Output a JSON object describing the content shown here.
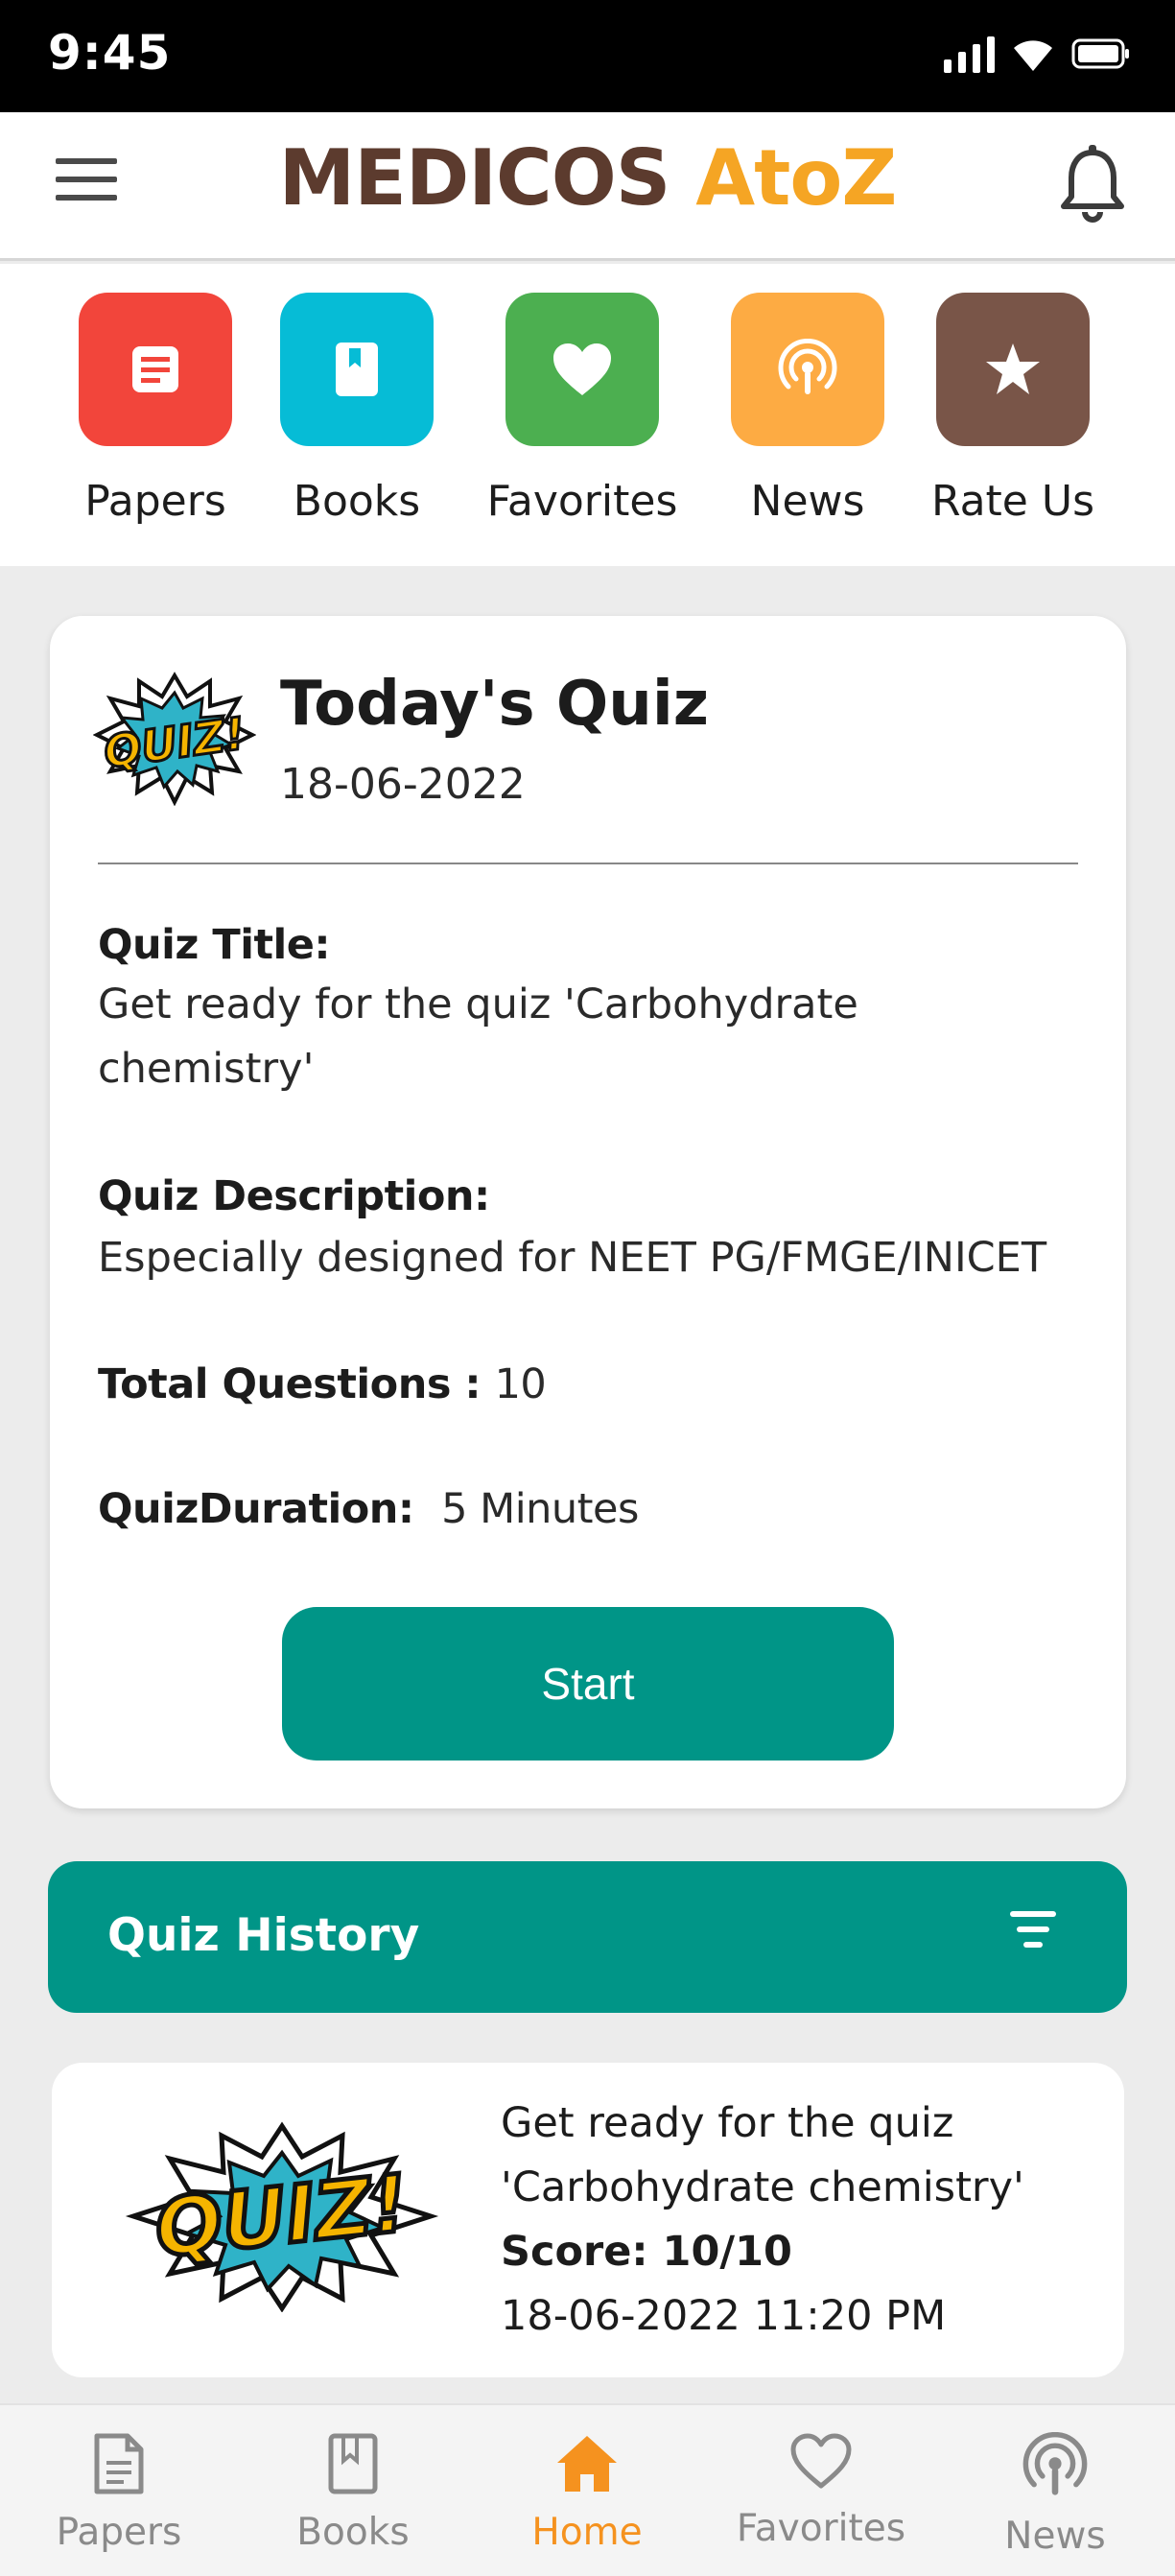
{
  "status_bar": {
    "time": "9:45"
  },
  "header": {
    "logo_part1": "MEDICOS",
    "logo_part2": "AtoZ"
  },
  "shortcuts": [
    {
      "label": "Papers",
      "icon": "document-icon",
      "color": "#f2453b"
    },
    {
      "label": "Books",
      "icon": "book-icon",
      "color": "#06bcd6"
    },
    {
      "label": "Favorites",
      "icon": "heart-icon",
      "color": "#4caf50"
    },
    {
      "label": "News",
      "icon": "broadcast-icon",
      "color": "#fdab43"
    },
    {
      "label": "Rate Us",
      "icon": "star-icon",
      "color": "#795548"
    }
  ],
  "quiz_card": {
    "logo_text": "QUIZ!",
    "heading": "Today's Quiz",
    "date": "18-06-2022",
    "title_label": "Quiz Title:",
    "title_value": "Get ready for the quiz 'Carbohydrate chemistry'",
    "description_label": "Quiz Description:",
    "description_value": "Especially designed for NEET PG/FMGE/INICET",
    "total_questions_label": "Total Questions :",
    "total_questions_value": "10",
    "duration_label": "QuizDuration:",
    "duration_value": "5 Minutes",
    "start_label": "Start"
  },
  "quiz_history": {
    "title": "Quiz History",
    "items": [
      {
        "logo_text": "QUIZ!",
        "title": "Get ready for the quiz 'Carbohydrate chemistry'",
        "score": "Score: 10/10",
        "datetime": "18-06-2022 11:20 PM"
      }
    ]
  },
  "bottom_nav": {
    "items": [
      {
        "label": "Papers",
        "icon": "document-outline-icon"
      },
      {
        "label": "Books",
        "icon": "book-outline-icon"
      },
      {
        "label": "Home",
        "icon": "home-icon",
        "active": true
      },
      {
        "label": "Favorites",
        "icon": "heart-outline-icon"
      },
      {
        "label": "News",
        "icon": "broadcast-icon"
      }
    ],
    "active_color": "#f5921f",
    "inactive_color": "#8a8a8a"
  },
  "colors": {
    "primary": "#009587",
    "brand_brown": "#5c3b2e",
    "brand_orange": "#f5a524"
  }
}
